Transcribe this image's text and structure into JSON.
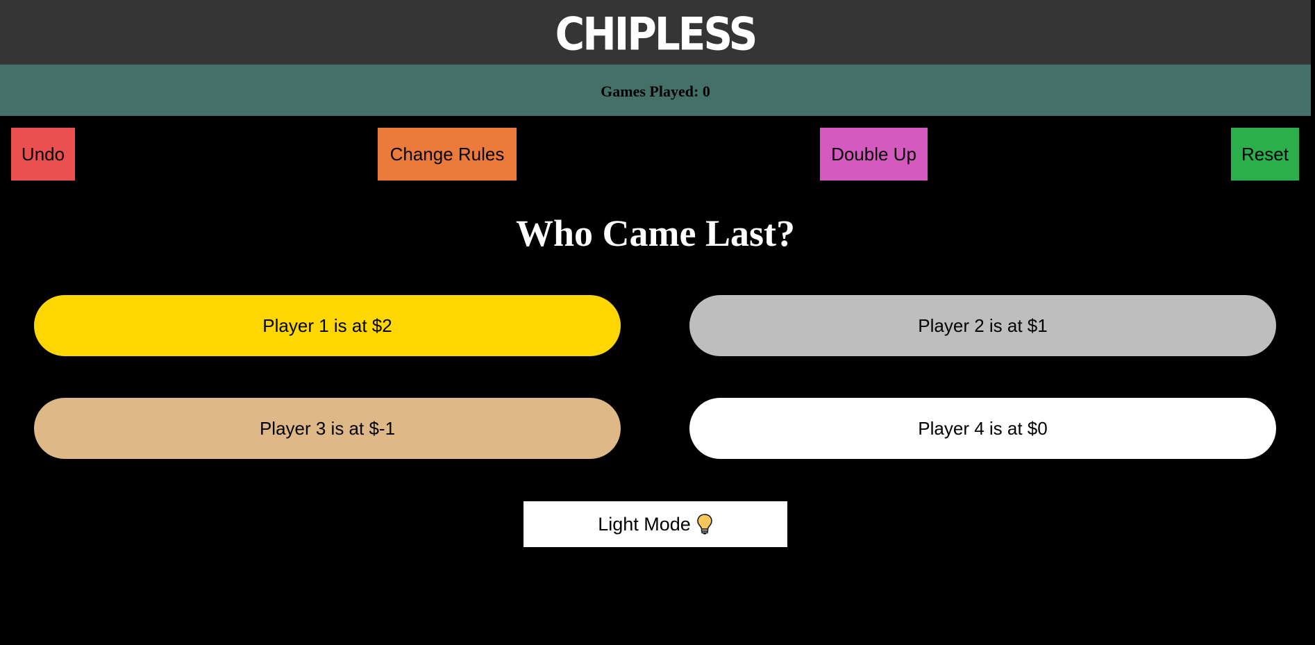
{
  "header": {
    "title": "CHIPLESS"
  },
  "games": {
    "label": "Games Played: 0"
  },
  "controls": {
    "undo": {
      "label": "Undo",
      "color": "#eb5050"
    },
    "change_rules": {
      "label": "Change Rules",
      "color": "#ec7a3a"
    },
    "double_up": {
      "label": "Double Up",
      "color": "#d55abf"
    },
    "reset": {
      "label": "Reset",
      "color": "#2aaf4a"
    }
  },
  "prompt": {
    "question": "Who Came Last?"
  },
  "players": [
    {
      "label": "Player 1 is at $2",
      "color": "#ffd700"
    },
    {
      "label": "Player 2 is at $1",
      "color": "#bebebe"
    },
    {
      "label": "Player 3 is at $-1",
      "color": "#deb887"
    },
    {
      "label": "Player 4 is at $0",
      "color": "#ffffff"
    }
  ],
  "mode_toggle": {
    "label": "Light Mode",
    "icon": "lightbulb-icon"
  },
  "colors": {
    "background": "#000000",
    "header_bg": "#353535",
    "games_bar_bg": "#447068"
  }
}
